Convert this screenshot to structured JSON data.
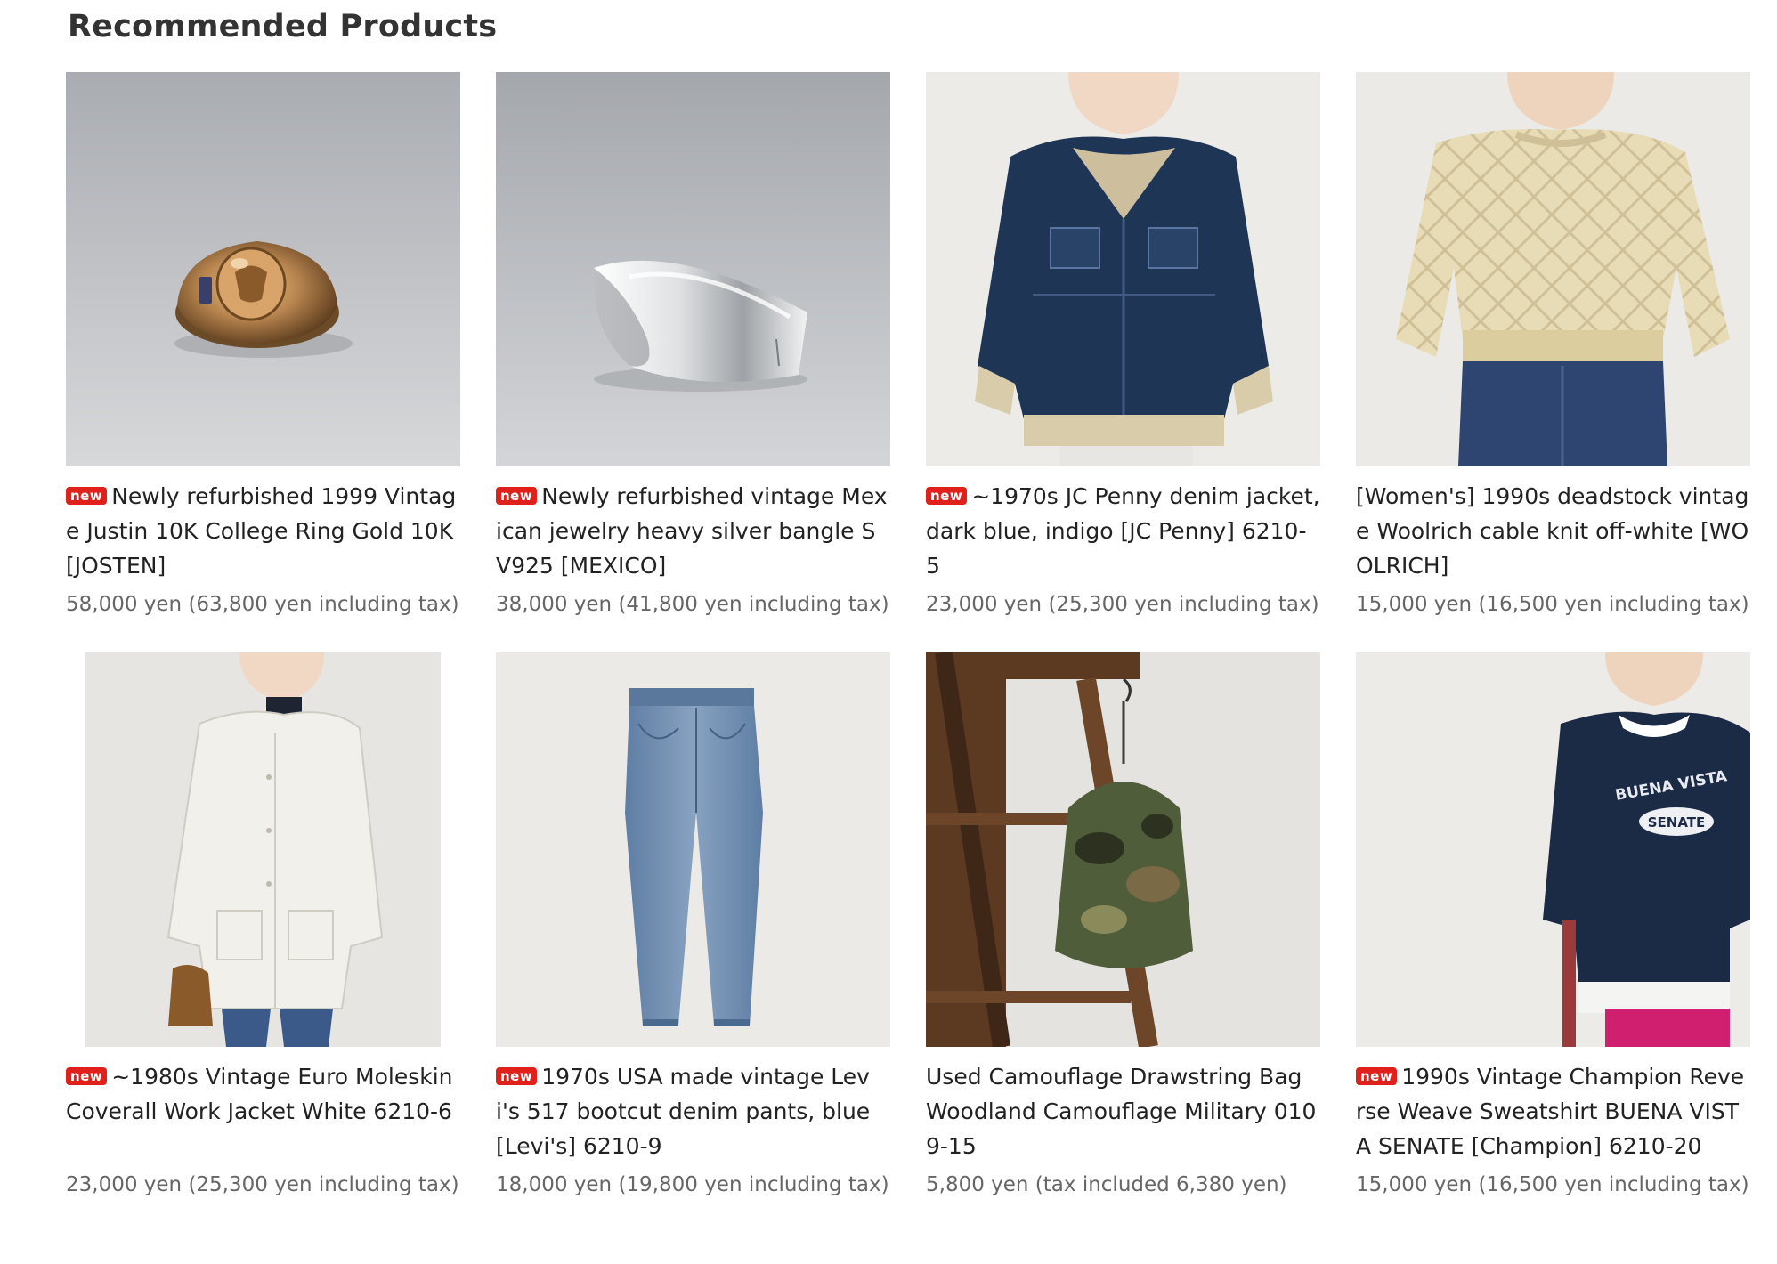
{
  "section": {
    "title": "Recommended Products",
    "new_badge_label": "new"
  },
  "colors": {
    "badge": "#e0201b",
    "title_text": "#222222",
    "price_text": "#666666"
  },
  "products": [
    {
      "is_new": true,
      "title": "Newly refurbished 1999 Vintage Justin 10K College Ring Gold 10K [JOSTEN]",
      "price": "58,000 yen (63,800 yen including tax)",
      "image": "gold-college-ring-photo"
    },
    {
      "is_new": true,
      "title": "Newly refurbished vintage Mexican jewelry heavy silver bangle SV925 [MEXICO]",
      "price": "38,000 yen (41,800 yen including tax)",
      "image": "silver-bangle-photo"
    },
    {
      "is_new": true,
      "title": "~1970s JC Penny denim jacket, dark blue, indigo [JC Penny] 6210-5",
      "price": "23,000 yen (25,300 yen including tax)",
      "image": "denim-jacket-photo"
    },
    {
      "is_new": false,
      "title": "[Women's] 1990s deadstock vintage Woolrich cable knit off-white [WOOLRICH]",
      "price": "15,000 yen (16,500 yen including tax)",
      "image": "cable-knit-sweater-photo"
    },
    {
      "is_new": true,
      "title": "~1980s Vintage Euro Moleskin Coverall Work Jacket White 6210-6",
      "price": "23,000 yen (25,300 yen including tax)",
      "image": "white-coverall-jacket-photo"
    },
    {
      "is_new": true,
      "title": "1970s USA made vintage Levi's 517 bootcut denim pants, blue [Levi's] 6210-9",
      "price": "18,000 yen (19,800 yen including tax)",
      "image": "denim-pants-photo"
    },
    {
      "is_new": false,
      "title": "Used Camouflage Drawstring Bag Woodland Camouflage Military 0109-15",
      "price": "5,800 yen (tax included 6,380 yen)",
      "image": "camouflage-bag-photo"
    },
    {
      "is_new": true,
      "title": "1990s Vintage Champion Reverse Weave Sweatshirt BUENA VISTA SENATE [Champion] 6210-20",
      "price": "15,000 yen (16,500 yen including tax)",
      "image": "navy-sweatshirt-photo",
      "print_line1": "BUENA VISTA",
      "print_line2": "SENATE"
    }
  ]
}
